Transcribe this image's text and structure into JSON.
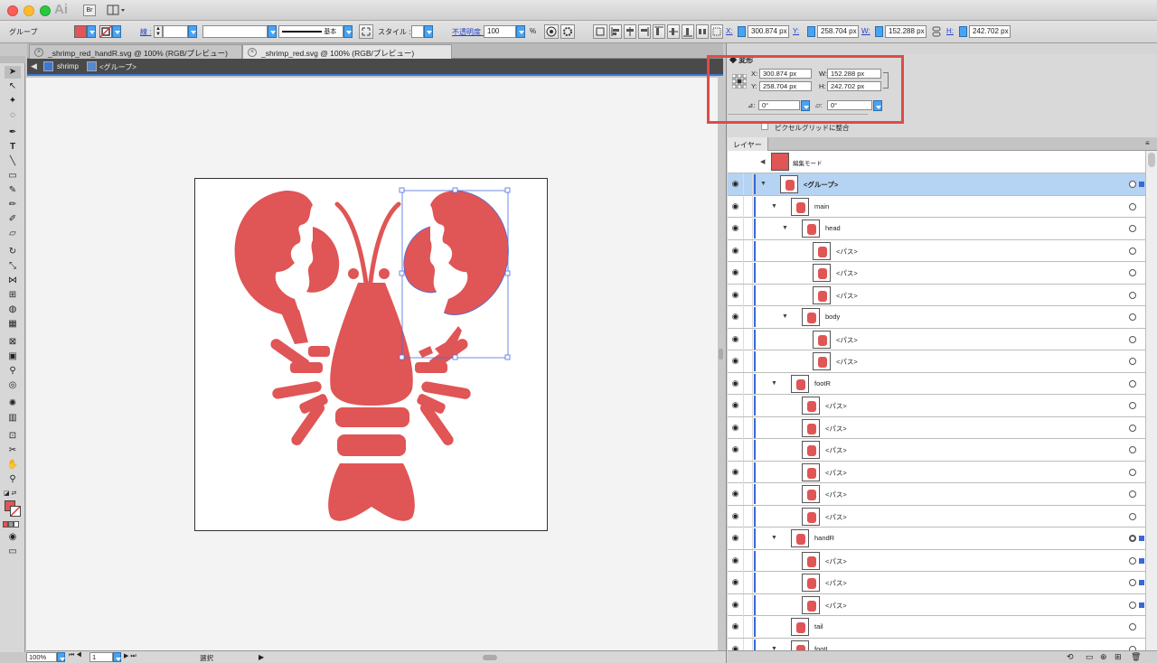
{
  "app": {
    "logo": "Ai",
    "bridge": "Br"
  },
  "control_bar": {
    "selection_type": "グループ",
    "stroke_label": "線 :",
    "stroke_style": "基本",
    "style_label": "スタイル :",
    "opacity_label": "不透明度 :",
    "opacity_value": "100",
    "opacity_unit": "%",
    "x_label": "X:",
    "x_value": "300.874 px",
    "y_label": "Y:",
    "y_value": "258.704 px",
    "w_label": "W:",
    "w_value": "152.288 px",
    "h_label": "H:",
    "h_value": "242.702 px",
    "fill_color": "#e05555"
  },
  "tabs": [
    {
      "label": "_shrimp_red_handR.svg @ 100% (RGB/プレビュー)",
      "active": false
    },
    {
      "label": "_shrimp_red.svg @ 100% (RGB/プレビュー)",
      "active": true
    }
  ],
  "breadcrumb": {
    "layer": "shrimp",
    "group": "<グループ>"
  },
  "transform_panel": {
    "title": "変形",
    "x_label": "X:",
    "x_value": "300.874 px",
    "y_label": "Y:",
    "y_value": "258.704 px",
    "w_label": "W:",
    "w_value": "152.288 px",
    "h_label": "H:",
    "h_value": "242.702 px",
    "rotate_value": "0°",
    "shear_value": "0°",
    "pixel_grid_label": "ピクセルグリッドに整合"
  },
  "layers_panel": {
    "title": "レイヤー",
    "mode_label": "編集モード",
    "rows": [
      {
        "name": "<グループ>",
        "indent": 0,
        "expanded": true,
        "selected": true
      },
      {
        "name": "main",
        "indent": 1,
        "expanded": true
      },
      {
        "name": "head",
        "indent": 2,
        "expanded": true
      },
      {
        "name": "<パス>",
        "indent": 3
      },
      {
        "name": "<パス>",
        "indent": 3
      },
      {
        "name": "<パス>",
        "indent": 3
      },
      {
        "name": "body",
        "indent": 2,
        "expanded": true
      },
      {
        "name": "<パス>",
        "indent": 3
      },
      {
        "name": "<パス>",
        "indent": 3
      },
      {
        "name": "footR",
        "indent": 1,
        "expanded": true
      },
      {
        "name": "<パス>",
        "indent": 2
      },
      {
        "name": "<パス>",
        "indent": 2
      },
      {
        "name": "<パス>",
        "indent": 2
      },
      {
        "name": "<パス>",
        "indent": 2
      },
      {
        "name": "<パス>",
        "indent": 2
      },
      {
        "name": "<パス>",
        "indent": 2
      },
      {
        "name": "handR",
        "indent": 1,
        "expanded": true,
        "has_selection": true
      },
      {
        "name": "<パス>",
        "indent": 2,
        "has_selection": true
      },
      {
        "name": "<パス>",
        "indent": 2,
        "has_selection": true
      },
      {
        "name": "<パス>",
        "indent": 2,
        "has_selection": true
      },
      {
        "name": "tail",
        "indent": 1
      },
      {
        "name": "footL",
        "indent": 1,
        "expanded": true
      }
    ]
  },
  "status_bar": {
    "zoom": "100%",
    "page": "1",
    "tool": "選択"
  },
  "colors": {
    "lobster": "#e05555",
    "selection": "#3a68d8",
    "highlight": "#e04a4a"
  }
}
